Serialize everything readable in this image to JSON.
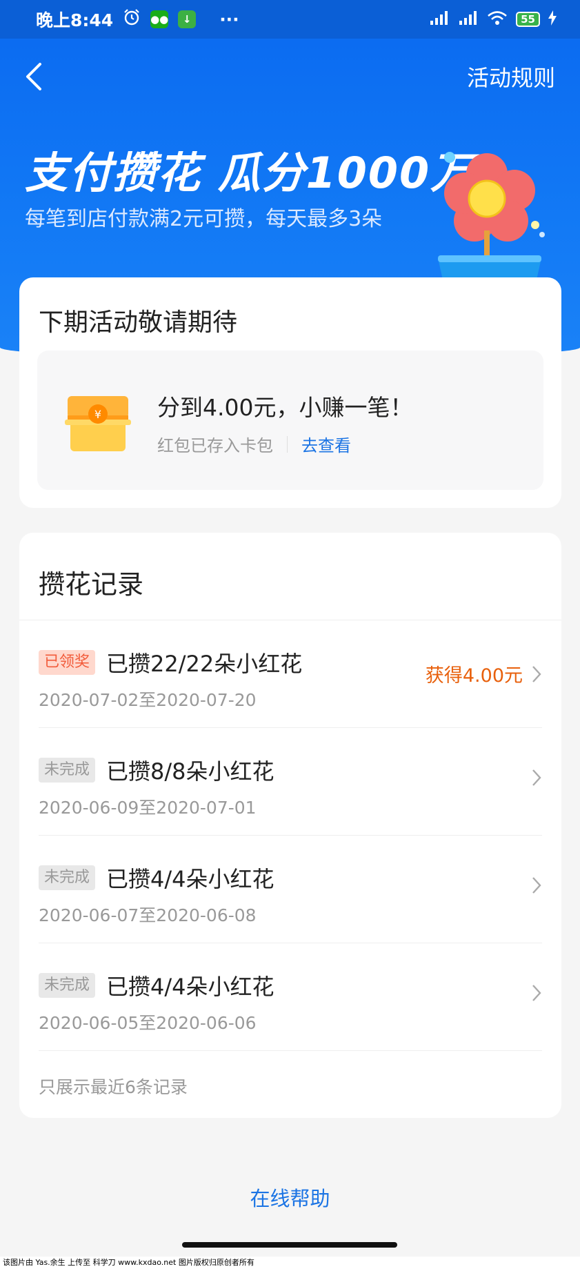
{
  "status": {
    "time": "晚上8:44",
    "battery": "55",
    "dots": "···"
  },
  "nav": {
    "rules": "活动规则"
  },
  "hero": {
    "title": "支付攒花 瓜分1000万",
    "subtitle": "每笔到店付款满2元可攒，每天最多3朵"
  },
  "next": {
    "title": "下期活动敬请期待",
    "reward_main": "分到4.00元，小赚一笔！",
    "reward_sub": "红包已存入卡包",
    "view_link": "去查看"
  },
  "records": {
    "title": "攒花记录",
    "items": [
      {
        "badge": "已领奖",
        "title": "已攒22/22朵小红花",
        "date": "2020-07-02至2020-07-20",
        "reward": "获得4.00元"
      },
      {
        "badge": "未完成",
        "title": "已攒8/8朵小红花",
        "date": "2020-06-09至2020-07-01",
        "reward": ""
      },
      {
        "badge": "未完成",
        "title": "已攒4/4朵小红花",
        "date": "2020-06-07至2020-06-08",
        "reward": ""
      },
      {
        "badge": "未完成",
        "title": "已攒4/4朵小红花",
        "date": "2020-06-05至2020-06-06",
        "reward": ""
      }
    ],
    "footnote": "只展示最近6条记录"
  },
  "help": "在线帮助",
  "watermark": "该图片由 Yas.余生 上传至 科学刀 www.kxdao.net 图片版权归原创者所有",
  "colors": {
    "primary_blue": "#1279f5",
    "link_blue": "#1b74e4",
    "reward_orange": "#e8600c"
  }
}
